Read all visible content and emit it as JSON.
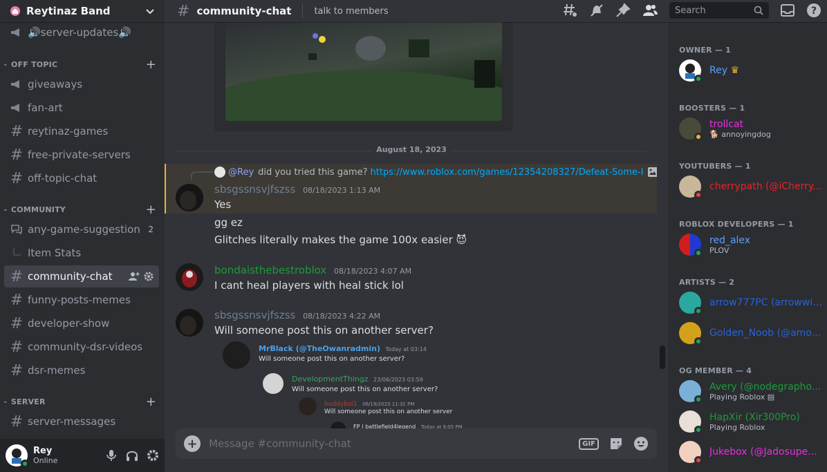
{
  "server": {
    "name": "Reytinaz Band"
  },
  "sidebar": {
    "channels": [
      {
        "name": "🔊server-updates🔊",
        "icon": "announcement-icon"
      },
      {
        "name": "giveaways",
        "icon": "announcement-icon"
      },
      {
        "name": "fan-art",
        "icon": "announcement-icon"
      },
      {
        "name": "reytinaz-games",
        "icon": "hash-icon"
      },
      {
        "name": "free-private-servers",
        "icon": "hash-icon"
      },
      {
        "name": "off-topic-chat",
        "icon": "hash-icon"
      },
      {
        "name": "any-game-suggestion",
        "icon": "forum-icon",
        "count": "2"
      },
      {
        "name": "Item Stats",
        "icon": "thread-icon"
      },
      {
        "name": "community-chat",
        "icon": "hash-icon"
      },
      {
        "name": "funny-posts-memes",
        "icon": "hash-icon"
      },
      {
        "name": "developer-show",
        "icon": "hash-icon"
      },
      {
        "name": "community-dsr-videos",
        "icon": "hash-icon"
      },
      {
        "name": "dsr-memes",
        "icon": "hash-icon"
      },
      {
        "name": "server-messages",
        "icon": "hash-icon"
      }
    ],
    "categories": [
      "OFF TOPIC",
      "COMMUNITY",
      "SERVER"
    ]
  },
  "user": {
    "name": "Rey",
    "status": "Online"
  },
  "topbar": {
    "channel": "community-chat",
    "topic": "talk to members",
    "search_placeholder": "Search"
  },
  "chat": {
    "date_divider": "August 18, 2023",
    "reply": {
      "mention": "@Rey",
      "text": "did you tried this game?",
      "link": "https://www.roblox.com/games/12354208327/Defeat-Some-I"
    },
    "messages": [
      {
        "author": "sbsgssnsvjfszss",
        "time": "08/18/2023 1:13 AM",
        "lines": [
          "Yes",
          "gg ez",
          "Glitches literally makes the game 100x easier 😈"
        ]
      },
      {
        "author": "bondaisthebestroblox",
        "time": "08/18/2023 4:07 AM",
        "lines": [
          "I cant heal players with heal stick lol"
        ]
      },
      {
        "author": "sbsgssnsvjfszss",
        "time": "08/18/2023 4:22 AM",
        "lines": [
          "Will someone post this on another server?"
        ]
      }
    ],
    "nested": [
      {
        "author": "MrBlack (@TheOwanradmin)",
        "time": "Today at 03:14",
        "text": "Will someone post this on another server?"
      },
      {
        "author": "DevelopmentThingz",
        "time": "23/06/2023 03:59",
        "text": "Will someone post this on another server?"
      },
      {
        "author": "buddyboi1",
        "time": "06/19/2023 11:31 PM",
        "text": "Will someone post this on another server"
      },
      {
        "author": "FP | battlefield4legend",
        "time": "Today at 9:05 PM",
        "text": ""
      }
    ]
  },
  "composer": {
    "placeholder": "Message #community-chat",
    "gif": "GIF"
  },
  "members": {
    "groups": [
      {
        "title": "OWNER — 1",
        "members": [
          {
            "name": "Rey",
            "sub": "",
            "color": "#5aa0ff",
            "status": "online"
          }
        ]
      },
      {
        "title": "BOOSTERS — 1",
        "members": [
          {
            "name": "trollcat",
            "sub": "annoyingdog",
            "color": "#e82fe0",
            "status": "idle"
          }
        ]
      },
      {
        "title": "YOUTUBERS — 1",
        "members": [
          {
            "name": "cherrypath (@iCherry...",
            "sub": "",
            "color": "#e5252a",
            "status": "dnd"
          }
        ]
      },
      {
        "title": "ROBLOX DEVELOPERS — 1",
        "members": [
          {
            "name": "red_alex",
            "sub": "PLOV",
            "color": "#5aa0ff",
            "status": "online"
          }
        ]
      },
      {
        "title": "ARTISTS — 2",
        "members": [
          {
            "name": "arrow777PC (arrowwil...",
            "sub": "",
            "color": "#2863d6",
            "status": "online"
          },
          {
            "name": "Golden_Noob (@amo...",
            "sub": "",
            "color": "#2863d6",
            "status": "online"
          }
        ]
      },
      {
        "title": "OG MEMBER — 4",
        "members": [
          {
            "name": "Avery (@nodegrapho...",
            "sub": "Playing Roblox",
            "color": "#1f9a3a",
            "status": "online"
          },
          {
            "name": "HapXir (Xir300Pro)",
            "sub": "Playing Roblox",
            "color": "#1f9a3a",
            "status": "online"
          },
          {
            "name": "Jukebox (@Jadosupe...",
            "sub": "",
            "color": "#e82fe0",
            "status": "dnd"
          }
        ]
      }
    ]
  },
  "colors": {
    "accent": "#5865f2",
    "online": "#23a55a",
    "idle": "#f0b232",
    "dnd": "#f23f43"
  }
}
